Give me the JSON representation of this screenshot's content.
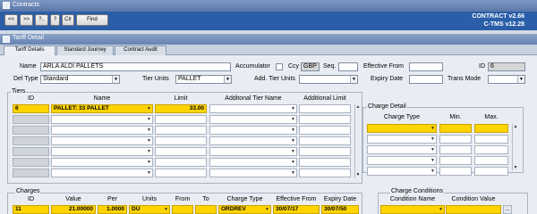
{
  "contracts_window": {
    "title": "Contracts",
    "toolbar": {
      "first": "<<",
      "next": ">>",
      "help": "?..",
      "query": "?",
      "clear": "Clr",
      "find": "Find"
    },
    "app_title": "CONTRACT v2.66",
    "app_version": "C-TMS v12.28"
  },
  "tariff_window": {
    "title": "Tariff Detail",
    "tabs": [
      "Tariff Details",
      "Standard Journey",
      "Contract Audit"
    ]
  },
  "form": {
    "name_label": "Name",
    "name_value": "ARLA ALDI PALLETS",
    "accumulator_label": "Accumulator",
    "ccy_label": "Ccy",
    "ccy_value": "GBP",
    "seq_label": "Seq.",
    "seq_value": "",
    "effective_from_label": "Effective From",
    "effective_from_value": "",
    "id_label": "ID",
    "id_value": "6",
    "del_type_label": "Del Type",
    "del_type_value": "Standard",
    "tier_units_label": "Tier Units",
    "tier_units_value": "PALLET",
    "add_tier_units_label": "Add. Tier Units",
    "add_tier_units_value": "",
    "expiry_date_label": "Expiry Date",
    "expiry_date_value": "",
    "trans_mode_label": "Trans Mode",
    "trans_mode_value": ""
  },
  "tiers": {
    "title": "Tiers",
    "headers": {
      "id": "ID",
      "name": "Name",
      "limit": "Limit",
      "add_name": "Additonal Tier Name",
      "add_limit": "Additional Limit"
    },
    "rows": [
      {
        "id": "6",
        "name": "PALLET: 33 PALLET",
        "limit": "33.00",
        "add_name": "",
        "add_limit": ""
      },
      {
        "id": "",
        "name": "",
        "limit": "",
        "add_name": "",
        "add_limit": ""
      },
      {
        "id": "",
        "name": "",
        "limit": "",
        "add_name": "",
        "add_limit": ""
      },
      {
        "id": "",
        "name": "",
        "limit": "",
        "add_name": "",
        "add_limit": ""
      },
      {
        "id": "",
        "name": "",
        "limit": "",
        "add_name": "",
        "add_limit": ""
      },
      {
        "id": "",
        "name": "",
        "limit": "",
        "add_name": "",
        "add_limit": ""
      },
      {
        "id": "",
        "name": "",
        "limit": "",
        "add_name": "",
        "add_limit": ""
      }
    ]
  },
  "charge_detail": {
    "title": "Charge Detail",
    "headers": {
      "charge_type": "Charge Type",
      "min": "Min.",
      "max": "Max."
    },
    "rows": [
      {
        "charge_type": "",
        "min": "",
        "max": ""
      },
      {
        "charge_type": "",
        "min": "",
        "max": ""
      },
      {
        "charge_type": "",
        "min": "",
        "max": ""
      },
      {
        "charge_type": "",
        "min": "",
        "max": ""
      },
      {
        "charge_type": "",
        "min": "",
        "max": ""
      }
    ]
  },
  "charges": {
    "title": "Charges",
    "headers": {
      "id": "ID",
      "value": "Value",
      "per": "Per",
      "units": "Units",
      "from": "From",
      "to": "To",
      "charge_type": "Charge Type",
      "effective_from": "Effective From",
      "expiry_date": "Expiry Date"
    },
    "rows": [
      {
        "id": "11",
        "value": "21.00000",
        "per": "1.0000",
        "units": "DU",
        "from": "",
        "to": "",
        "charge_type": "ORDREV",
        "effective_from": "30/07/17",
        "expiry_date": "30/07/50"
      }
    ]
  },
  "charge_conditions": {
    "title": "Charge Conditions",
    "headers": {
      "condition_name": "Condition Name",
      "condition_value": "Condition Value"
    },
    "rows": [
      {
        "condition_name": "",
        "condition_value": "",
        "ellipsis": "..."
      }
    ]
  },
  "colors": {
    "accent": "#2a5ea8",
    "highlight": "#ffd400",
    "panel": "#e9edf3"
  }
}
